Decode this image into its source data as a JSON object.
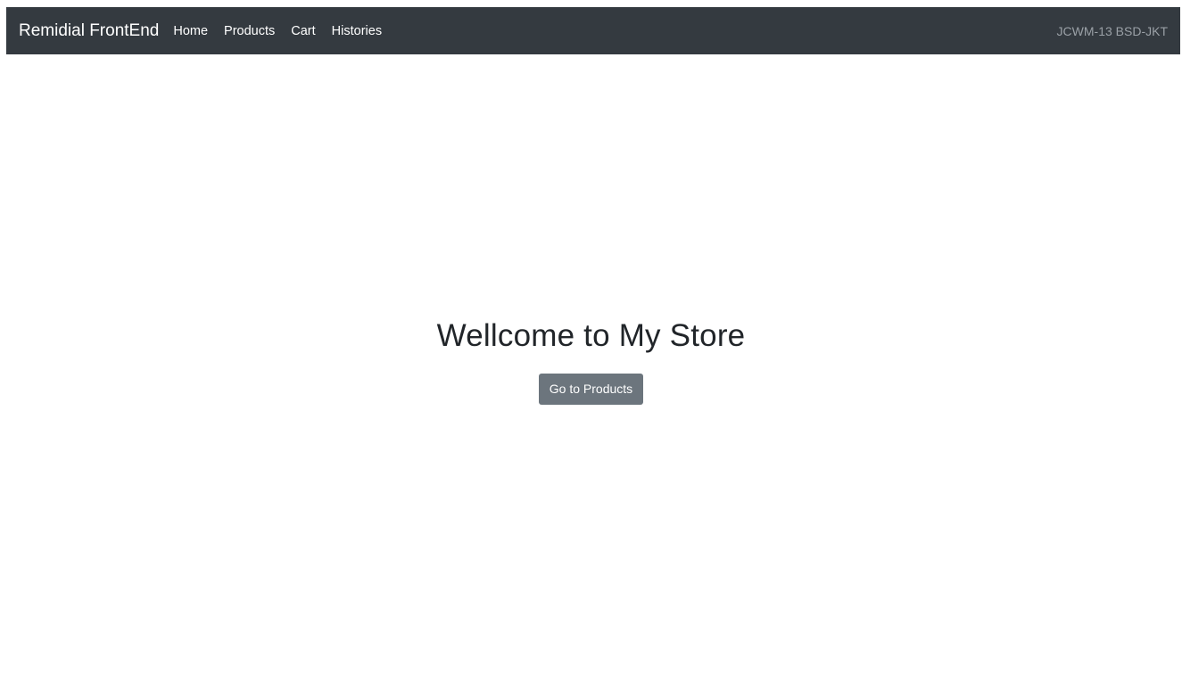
{
  "navbar": {
    "brand": "Remidial FrontEnd",
    "links": [
      {
        "label": "Home"
      },
      {
        "label": "Products"
      },
      {
        "label": "Cart"
      },
      {
        "label": "Histories"
      }
    ],
    "right_text": "JCWM-13 BSD-JKT",
    "background_color": "#343a40"
  },
  "hero": {
    "title": "Wellcome to My Store",
    "button_label": "Go to Products",
    "button_color": "#6c757d"
  }
}
